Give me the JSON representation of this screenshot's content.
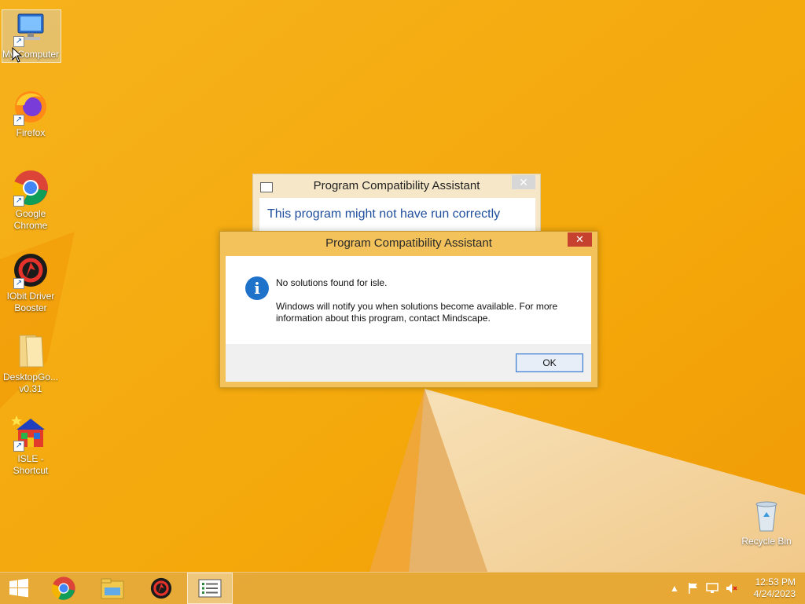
{
  "desktop": {
    "icons": [
      {
        "label": "My Computer"
      },
      {
        "label": "Firefox"
      },
      {
        "label": "Google Chrome"
      },
      {
        "label": "IObit Driver Booster"
      },
      {
        "label": "DesktopGo... v0.31"
      },
      {
        "label": "ISLE - Shortcut"
      },
      {
        "label": "Recycle Bin"
      }
    ]
  },
  "dialog_back": {
    "title": "Program Compatibility Assistant",
    "message": "This program might not have run correctly",
    "close_glyph": "✕"
  },
  "dialog_front": {
    "title": "Program Compatibility Assistant",
    "close_glyph": "✕",
    "main_instruction": "No solutions found for isle.",
    "detail": "Windows will notify you when solutions become available. For more information about this program, contact Mindscape.",
    "ok_label": "OK"
  },
  "taskbar": {
    "pinned": [
      "start-button",
      "chrome",
      "file-explorer",
      "driver-booster",
      "compatibility-assistant"
    ],
    "time": "12:53 PM",
    "date": "4/24/2023"
  },
  "colors": {
    "wallpaper": "#f4a80a",
    "accent_close": "#c7412f",
    "link_blue": "#1f4e9c"
  }
}
